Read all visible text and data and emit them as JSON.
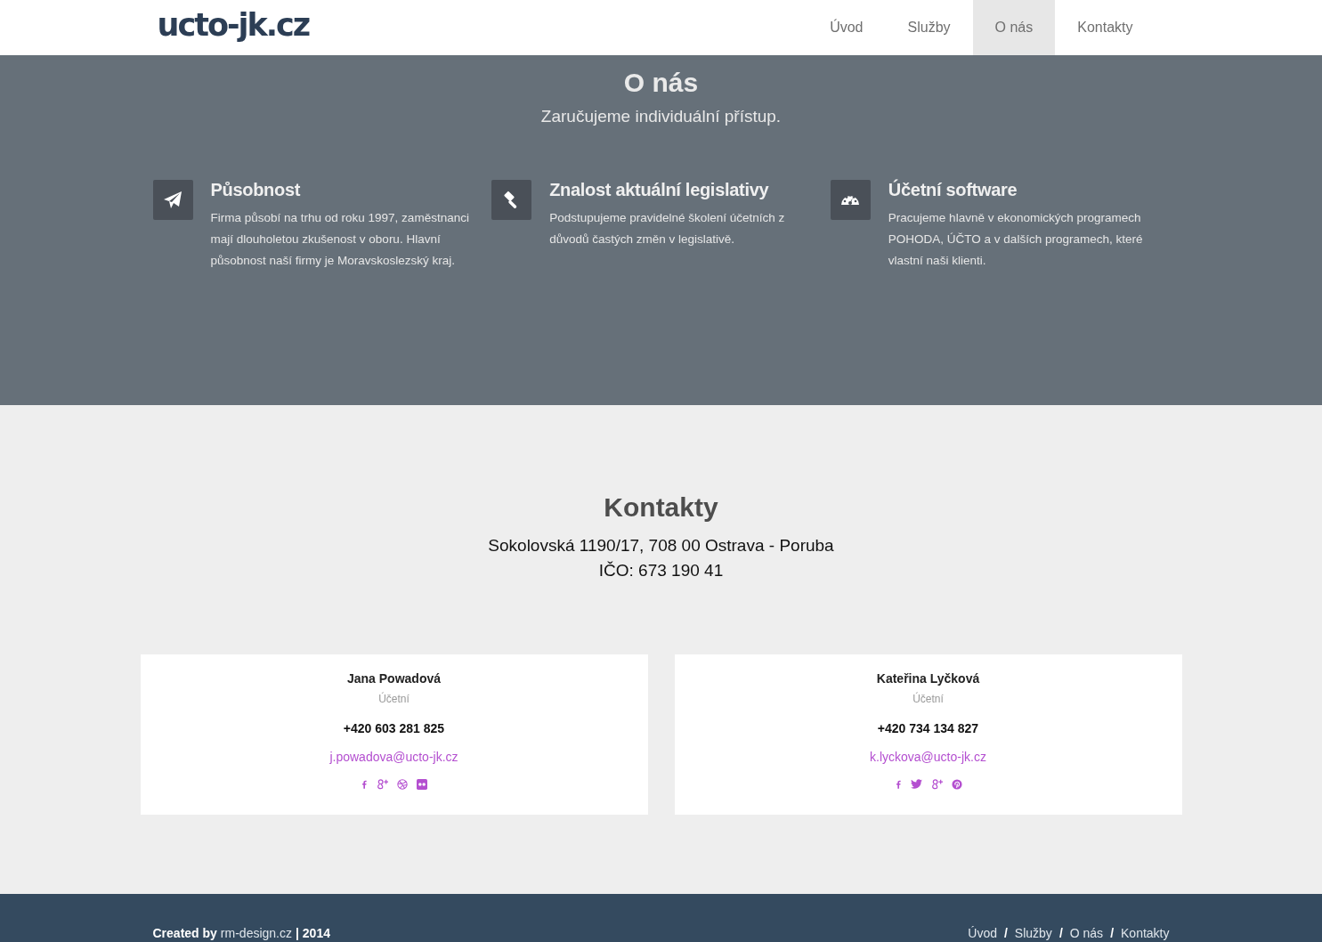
{
  "header": {
    "logo": "ucto-jk.cz",
    "nav": [
      {
        "label": "Úvod",
        "selected": false
      },
      {
        "label": "Služby",
        "selected": false
      },
      {
        "label": "O nás",
        "selected": true
      },
      {
        "label": "Kontakty",
        "selected": false
      }
    ]
  },
  "about": {
    "title": "O nás",
    "subtitle": "Zaručujeme individuální přístup.",
    "features": [
      {
        "kind": "plane",
        "title": "Působnost",
        "text": "Firma působí na trhu od roku 1997, zaměstnanci mají dlouholetou zkušenost v oboru. Hlavní působnost naší firmy je Moravskoslezský kraj."
      },
      {
        "kind": "gavel",
        "title": "Znalost aktuální legislativy",
        "text": "Podstupujeme pravidelné školení účetních z důvodů častých změn v legislativě."
      },
      {
        "kind": "gauge",
        "title": "Účetní software",
        "text": "Pracujeme hlavně v ekonomických programech POHODA, ÚČTO  a v dalších programech, které vlastní naši klienti."
      }
    ]
  },
  "contacts": {
    "title": "Kontakty",
    "address": "Sokolovská 1190/17, 708 00 Ostrava - Poruba",
    "ico": "IČO: 673 190 41",
    "people": [
      {
        "name": "Jana Powadová",
        "role": "Účetní",
        "phone": "+420 603 281 825",
        "email": "j.powadova@ucto-jk.cz",
        "social": [
          {
            "kind": "facebook"
          },
          {
            "kind": "google-plus"
          },
          {
            "kind": "dribbble"
          },
          {
            "kind": "flickr"
          }
        ]
      },
      {
        "name": "Kateřina Lyčková",
        "role": "Účetní",
        "phone": "+420 734 134 827",
        "email": "k.lyckova@ucto-jk.cz",
        "social": [
          {
            "kind": "facebook"
          },
          {
            "kind": "twitter"
          },
          {
            "kind": "google-plus"
          },
          {
            "kind": "pinterest"
          }
        ]
      }
    ]
  },
  "footer": {
    "credit_prefix": "Created by",
    "credit_link": "rm-design.cz",
    "credit_suffix": "| 2014",
    "separator": "/",
    "nav": [
      "Úvod",
      "Služby",
      "O nás",
      "Kontakty"
    ]
  }
}
